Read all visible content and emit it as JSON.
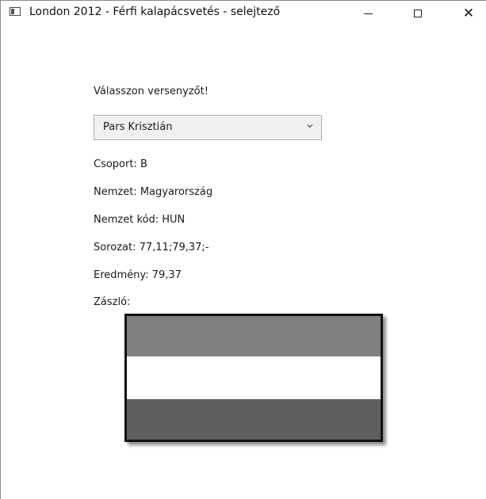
{
  "window": {
    "title": "London 2012 - Férfi kalapácsvetés - selejtező",
    "icon": "app-window-icon",
    "minimize_icon": "minimize-icon",
    "maximize_icon": "maximize-icon",
    "close_glyph": "✕"
  },
  "form": {
    "prompt": "Válasszon versenyzőt!",
    "selected_athlete": "Pars Krisztián",
    "chevron_icon": "chevron-down-icon"
  },
  "details": {
    "group": "Csoport: B",
    "nation": "Nemzet: Magyarország",
    "nation_code": "Nemzet kód: HUN",
    "series": "Sorozat: 77,11;79,37;-",
    "result": "Eredmény: 79,37",
    "flag_label": "Zászló:"
  },
  "flag": {
    "stripes": [
      "#808080",
      "#ffffff",
      "#5f5f5f"
    ],
    "border_color": "#111111"
  }
}
